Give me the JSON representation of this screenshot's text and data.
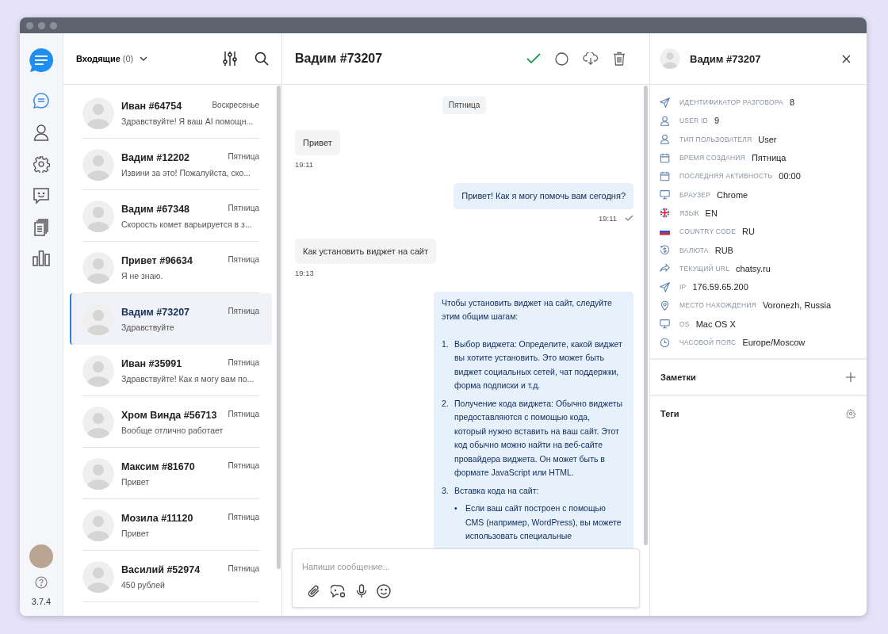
{
  "sidebar": {
    "nav": [
      {
        "kind": "chats",
        "selected": true
      },
      {
        "kind": "contacts",
        "selected": false
      },
      {
        "kind": "settings",
        "selected": false
      },
      {
        "kind": "bot",
        "selected": false
      },
      {
        "kind": "documents",
        "selected": false
      },
      {
        "kind": "stats",
        "selected": false
      }
    ],
    "version": "3.7.4"
  },
  "inbox": {
    "title": "Входящие",
    "count": "(0)"
  },
  "chats": [
    {
      "name": "Иван #64754",
      "date": "Воскресенье",
      "preview": "Здравствуйте! Я ваш AI помощн...",
      "selected": false
    },
    {
      "name": "Вадим #12202",
      "date": "Пятница",
      "preview": "Извини за это! Пожалуйста, ско...",
      "selected": false
    },
    {
      "name": "Вадим #67348",
      "date": "Пятница",
      "preview": "Скорость комет варьируется в з...",
      "selected": false
    },
    {
      "name": "Привет #96634",
      "date": "Пятница",
      "preview": "Я не знаю.",
      "selected": false
    },
    {
      "name": "Вадим #73207",
      "date": "Пятница",
      "preview": "Здравствуйте",
      "selected": true
    },
    {
      "name": "Иван #35991",
      "date": "Пятница",
      "preview": "Здравствуйте! Как я могу вам по...",
      "selected": false
    },
    {
      "name": "Хром Винда #56713",
      "date": "Пятница",
      "preview": "Вообще отлично работает",
      "selected": false
    },
    {
      "name": "Максим #81670",
      "date": "Пятница",
      "preview": "Привет",
      "selected": false
    },
    {
      "name": "Мозила #11120",
      "date": "Пятница",
      "preview": "Привет",
      "selected": false
    },
    {
      "name": "Василий #52974",
      "date": "Пятница",
      "preview": "450 рублей",
      "selected": false
    }
  ],
  "conversation": {
    "title": "Вадим #73207",
    "composer": {
      "placeholder": "Напиши сообщение..."
    }
  },
  "messages": [
    {
      "kind": "date",
      "text": "Пятница"
    },
    {
      "kind": "incoming",
      "text": "Привет",
      "time": "19:11"
    },
    {
      "kind": "outgoing",
      "text": "Привет! Как я могу помочь вам сегодня?",
      "time": "19:11",
      "read": true
    },
    {
      "kind": "incoming",
      "text": "Как установить виджет на сайт",
      "time": "19:13"
    },
    {
      "kind": "outgoing",
      "text": "Чтобы установить виджет на сайт, следуйте этим общим шагам:",
      "steps": [
        {
          "marker": "1.",
          "text": "Выбор виджета: Определите, какой виджет вы хотите установить. Это может быть виджет социальных сетей, чат поддержки, форма подписки и т.д."
        },
        {
          "marker": "2.",
          "text": "Получение кода виджета: Обычно виджеты предоставляются с помощью кода, который нужно вставить на ваш сайт. Этот код обычно можно найти на веб-сайте провайдера виджета. Он может быть в формате JavaScript или HTML."
        },
        {
          "marker": "3.",
          "text": "Вставка кода на сайт:",
          "bullets": [
            {
              "marker": "•",
              "text": "Если ваш сайт построен с помощью CMS (например, WordPress), вы можете использовать специальные"
            }
          ]
        }
      ]
    }
  ],
  "profile": {
    "name": "Вадим #73207",
    "fields": [
      {
        "kind": "send",
        "label": "ИДЕНТИФИКАТОР РАЗГОВОРА",
        "value": "8"
      },
      {
        "kind": "user",
        "label": "USER ID",
        "value": "9"
      },
      {
        "kind": "user",
        "label": "ТИП ПОЛЬЗОВАТЕЛЯ",
        "value": "User"
      },
      {
        "kind": "calendar",
        "label": "ВРЕМЯ СОЗДАНИЯ",
        "value": "Пятница"
      },
      {
        "kind": "calendar",
        "label": "ПОСЛЕДНЯЯ АКТИВНОСТЬ",
        "value": "00:00"
      },
      {
        "kind": "monitor",
        "label": "БРАУЗЕР",
        "value": "Chrome"
      },
      {
        "kind": "flag-uk",
        "label": "ЯЗЫК",
        "value": "EN"
      },
      {
        "kind": "flag-ru",
        "label": "COUNTRY CODE",
        "value": "RU"
      },
      {
        "kind": "currency",
        "label": "ВАЛЮТА",
        "value": "RUB"
      },
      {
        "kind": "share",
        "label": "ТЕКУЩИЙ URL",
        "value": "chatsy.ru"
      },
      {
        "kind": "send",
        "label": "IP",
        "value": "176.59.65.200"
      },
      {
        "kind": "pin",
        "label": "МЕСТО НАХОЖДЕНИЯ",
        "value": "Voronezh, Russia"
      },
      {
        "kind": "monitor",
        "label": "OS",
        "value": "Mac OS X"
      },
      {
        "kind": "clock",
        "label": "ЧАСОВОЙ ПОЯС",
        "value": "Europe/Moscow"
      }
    ],
    "sections": [
      {
        "kind": "add",
        "title": "Заметки"
      },
      {
        "kind": "settings",
        "title": "Теги"
      }
    ]
  }
}
